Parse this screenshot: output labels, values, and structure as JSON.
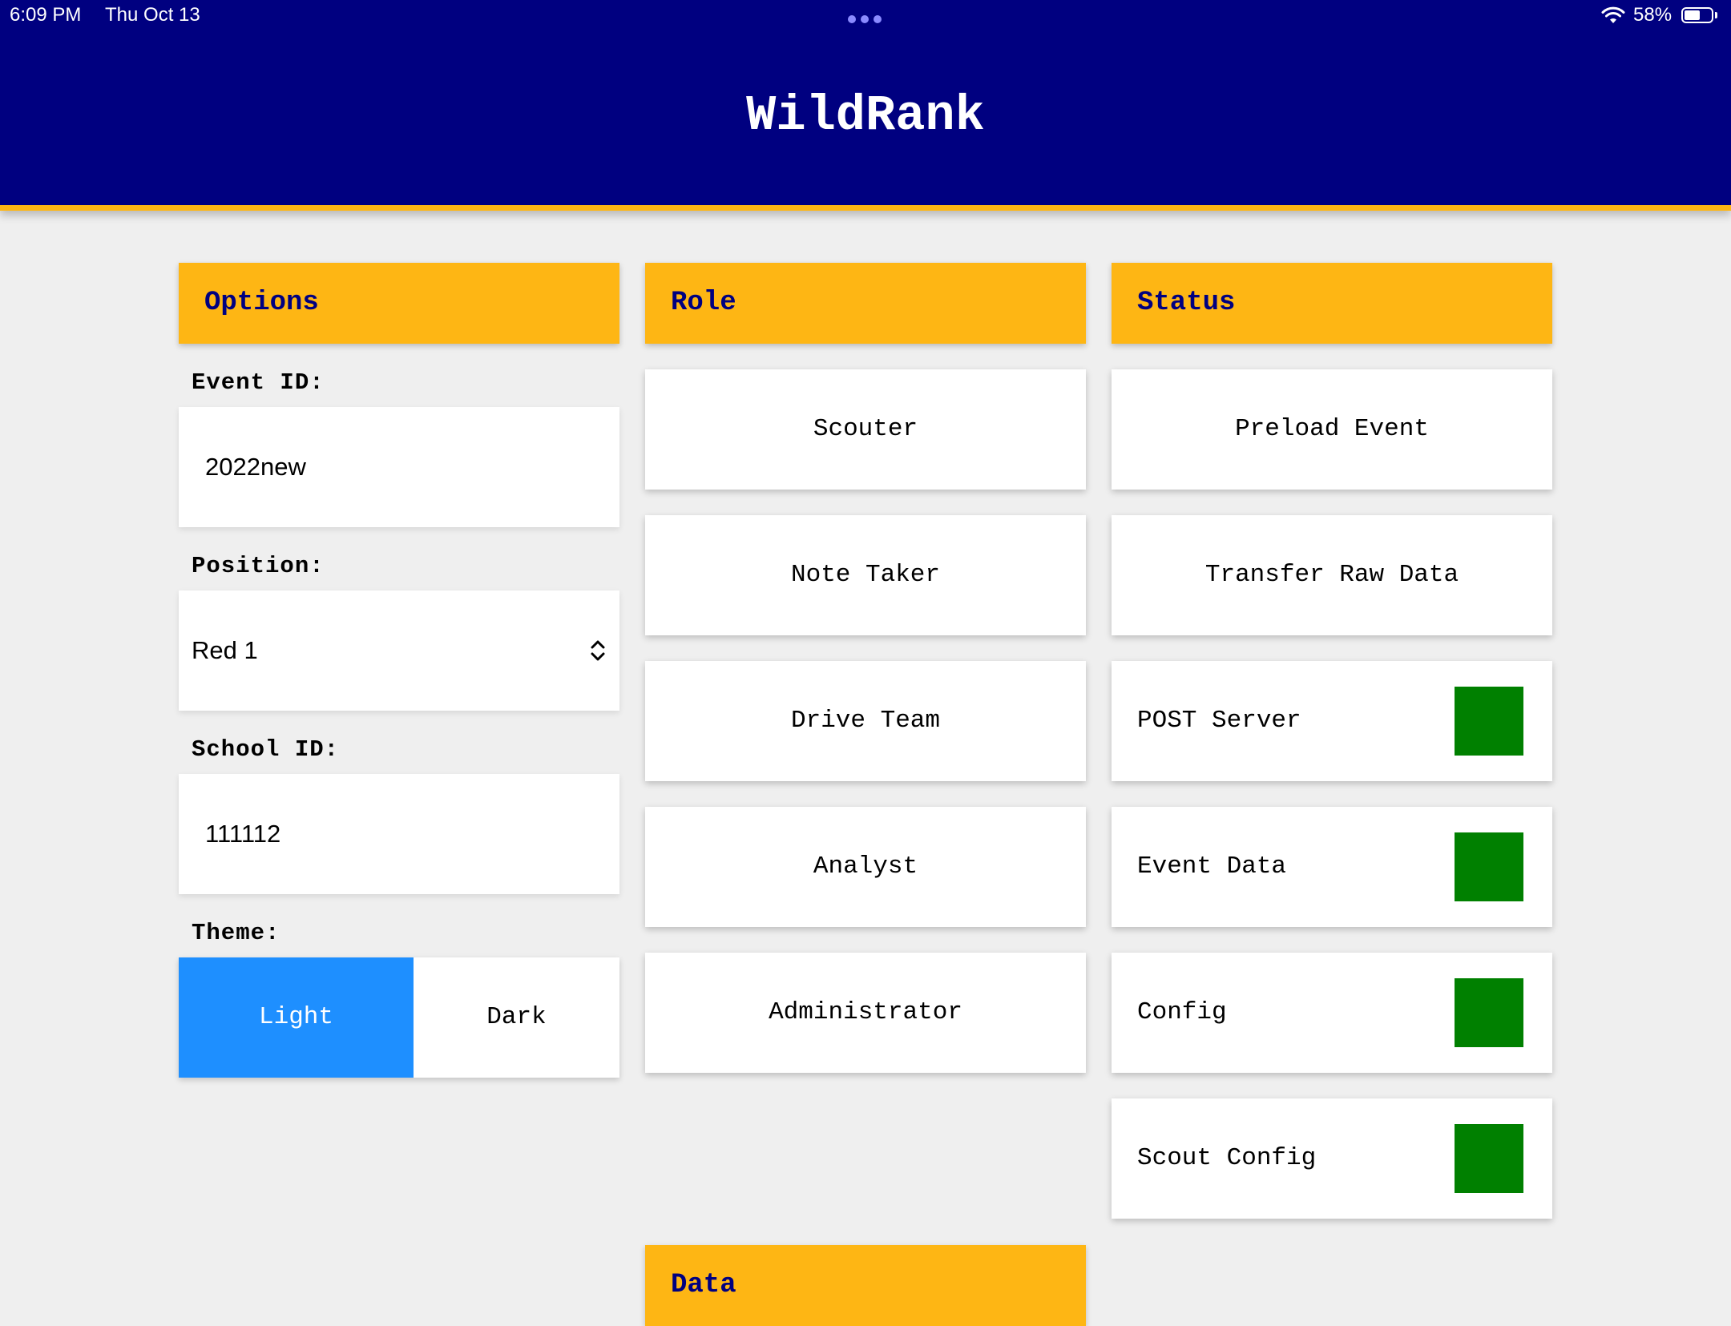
{
  "status_bar": {
    "time": "6:09 PM",
    "date": "Thu Oct 13",
    "battery_percent": "58%",
    "battery_level": 0.58,
    "icons": [
      "more-dots-icon",
      "wifi-icon",
      "battery-icon"
    ]
  },
  "app": {
    "title": "WildRank"
  },
  "options": {
    "header": "Options",
    "event_id": {
      "label": "Event ID:",
      "value": "2022new"
    },
    "position": {
      "label": "Position:",
      "value": "Red 1"
    },
    "school_id": {
      "label": "School ID:",
      "value": "111112"
    },
    "theme": {
      "label": "Theme:",
      "options": [
        "Light",
        "Dark"
      ],
      "selected": "Light"
    }
  },
  "role": {
    "header": "Role",
    "buttons": [
      "Scouter",
      "Note Taker",
      "Drive Team",
      "Analyst",
      "Administrator"
    ]
  },
  "status": {
    "header": "Status",
    "actions": [
      "Preload Event",
      "Transfer Raw Data"
    ],
    "indicators": [
      {
        "label": "POST Server",
        "state": "ok"
      },
      {
        "label": "Event Data",
        "state": "ok"
      },
      {
        "label": "Config",
        "state": "ok"
      },
      {
        "label": "Scout Config",
        "state": "ok"
      }
    ]
  },
  "data_section": {
    "header": "Data"
  },
  "colors": {
    "header_bg": "#000080",
    "accent": "#feb614",
    "selected_toggle": "#1e8fff",
    "status_ok": "#008000",
    "page_bg": "#efefef"
  }
}
